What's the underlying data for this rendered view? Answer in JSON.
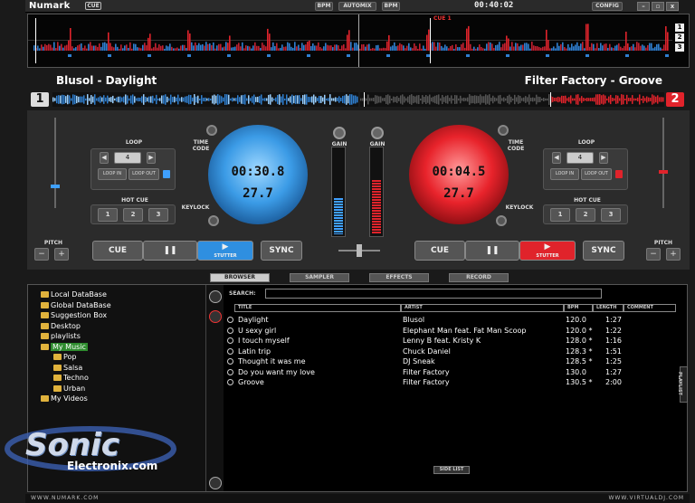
{
  "topbar": {
    "brand": "Numark",
    "brand_badge": "CUE",
    "bpm_left": "BPM",
    "automix": "AUTOMIX",
    "bpm_right": "BPM",
    "clock": "00:40:02",
    "config": "CONFIG",
    "minimize": "–",
    "maximize": "▫",
    "close": "x"
  },
  "overview": {
    "cue_marker": "CUE 1",
    "view_buttons": [
      "1",
      "2",
      "3"
    ]
  },
  "deck_left": {
    "number": "1",
    "title": "Blusol - Daylight",
    "loop_label": "LOOP",
    "loop_value": "4",
    "loop_in": "LOOP IN",
    "loop_out": "LOOP OUT",
    "hot_cue_label": "HOT CUE",
    "hot_cues": [
      "1",
      "2",
      "3"
    ],
    "timecode_label": "TIME CODE",
    "keylock_label": "KEYLOCK",
    "time_elapsed": "00:30.8",
    "time_sub": "27.7",
    "pitch_label": "PITCH",
    "pitch_minus": "−",
    "pitch_plus": "+",
    "cue": "CUE",
    "pause": "❚❚",
    "play": "▶",
    "stutter": "STUTTER",
    "sync": "SYNC",
    "color": "#2f8fe0"
  },
  "deck_right": {
    "number": "2",
    "title": "Filter Factory - Groove",
    "loop_label": "LOOP",
    "loop_value": "4",
    "loop_in": "LOOP IN",
    "loop_out": "LOOP OUT",
    "hot_cue_label": "HOT CUE",
    "hot_cues": [
      "1",
      "2",
      "3"
    ],
    "timecode_label": "TIME CODE",
    "keylock_label": "KEYLOCK",
    "time_elapsed": "00:04.5",
    "time_sub": "27.7",
    "pitch_label": "PITCH",
    "pitch_minus": "−",
    "pitch_plus": "+",
    "cue": "CUE",
    "pause": "❚❚",
    "play": "▶",
    "stutter": "STUTTER",
    "sync": "SYNC",
    "color": "#e0232b"
  },
  "mixer": {
    "gain_left": "GAIN",
    "gain_right": "GAIN"
  },
  "tabs": [
    "BROWSER",
    "SAMPLER",
    "EFFECTS",
    "RECORD"
  ],
  "tree": [
    {
      "label": "Local DataBase",
      "indent": 0
    },
    {
      "label": "Global DataBase",
      "indent": 0
    },
    {
      "label": "Suggestion Box",
      "indent": 0
    },
    {
      "label": "Desktop",
      "indent": 0
    },
    {
      "label": "playlists",
      "indent": 0
    },
    {
      "label": "My Music",
      "indent": 0,
      "selected": true
    },
    {
      "label": "Pop",
      "indent": 1
    },
    {
      "label": "Salsa",
      "indent": 1
    },
    {
      "label": "Techno",
      "indent": 1
    },
    {
      "label": "Urban",
      "indent": 1
    },
    {
      "label": "My Videos",
      "indent": 0
    }
  ],
  "search": {
    "label": "SEARCH:",
    "value": ""
  },
  "columns": {
    "title": "TITLE",
    "artist": "ARTIST",
    "bpm": "BPM",
    "length": "LENGTH",
    "comment": "COMMENT"
  },
  "tracks": [
    {
      "title": "Daylight",
      "artist": "Blusol",
      "bpm": "120.0",
      "length": "1:27"
    },
    {
      "title": "U sexy girl",
      "artist": "Elephant Man feat. Fat Man Scoop",
      "bpm": "120.0 *",
      "length": "1:22"
    },
    {
      "title": "I touch myself",
      "artist": "Lenny B feat. Kristy K",
      "bpm": "128.0 *",
      "length": "1:16"
    },
    {
      "title": "Latin trip",
      "artist": "Chuck Daniel",
      "bpm": "128.3 *",
      "length": "1:51"
    },
    {
      "title": "Thought it was me",
      "artist": "DJ Sneak",
      "bpm": "128.5 *",
      "length": "1:25"
    },
    {
      "title": "Do you want my love",
      "artist": "Filter Factory",
      "bpm": "130.0",
      "length": "1:27"
    },
    {
      "title": "Groove",
      "artist": "Filter Factory",
      "bpm": "130.5 *",
      "length": "2:00"
    }
  ],
  "side_list": "SIDE LIST",
  "playlist_tab": "PLAYLIST",
  "footer": {
    "left": "WWW.NUMARK.COM",
    "right": "WWW.VIRTUALDJ.COM"
  },
  "watermark": {
    "line1": "Sonic",
    "line2": "Electronix.com"
  }
}
